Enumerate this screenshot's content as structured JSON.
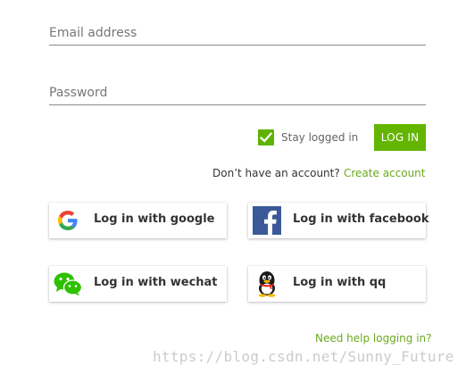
{
  "form": {
    "email": {
      "placeholder": "Email address",
      "value": ""
    },
    "password": {
      "placeholder": "Password",
      "value": ""
    },
    "stay_logged_in": {
      "label": "Stay logged in",
      "checked": true
    },
    "login_button": "LOG IN",
    "no_account_text": "Don’t have an account?",
    "create_account_link": "Create account",
    "help_link": "Need help logging in?"
  },
  "social": [
    {
      "label": "Log in with google",
      "icon": "google-icon"
    },
    {
      "label": "Log in with facebook",
      "icon": "facebook-icon"
    },
    {
      "label": "Log in with wechat",
      "icon": "wechat-icon"
    },
    {
      "label": "Log in with qq",
      "icon": "qq-icon"
    }
  ],
  "watermark": "https://blog.csdn.net/Sunny_Future",
  "colors": {
    "accent": "#63b500",
    "link": "#6aaa1e",
    "facebook": "#3b5998",
    "wechat": "#2dc100"
  }
}
